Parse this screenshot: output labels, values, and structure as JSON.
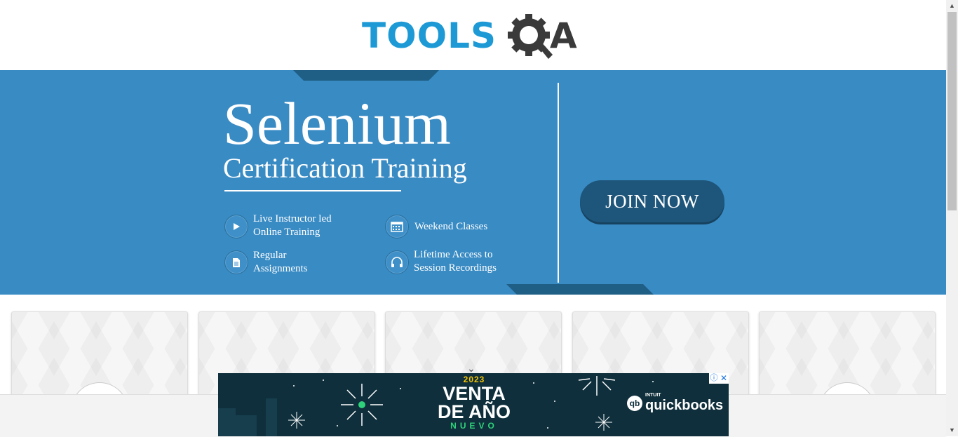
{
  "header": {
    "logo_text_left": "TOOLS",
    "logo_text_right": "A",
    "logo_colors": {
      "blue": "#1d9ad6",
      "dark": "#3a3a3a"
    }
  },
  "banner": {
    "title": "Selenium",
    "subtitle": "Certification Training",
    "features": [
      {
        "icon": "play-icon",
        "line1": "Live Instructor led",
        "line2": "Online Training"
      },
      {
        "icon": "calendar-icon",
        "line1": "Weekend Classes",
        "line2": ""
      },
      {
        "icon": "document-icon",
        "line1": "Regular",
        "line2": "Assignments"
      },
      {
        "icon": "headphones-icon",
        "line1": "Lifetime Access to",
        "line2": "Session Recordings"
      }
    ],
    "cta_label": "JOIN NOW",
    "colors": {
      "background": "#398bc4",
      "accent": "#1f5f86",
      "cta": "#1e557a"
    }
  },
  "ad": {
    "year": "2023",
    "line1": "VENTA",
    "line2": "DE AÑO",
    "line3": "NUEVO",
    "brand_small": "INTUIT",
    "brand_name": "quickbooks",
    "info_icon": "ⓘ",
    "close_icon": "✕"
  },
  "scrollbar": {
    "up": "▲",
    "down": "▼"
  },
  "cards_chevron": "⌄"
}
